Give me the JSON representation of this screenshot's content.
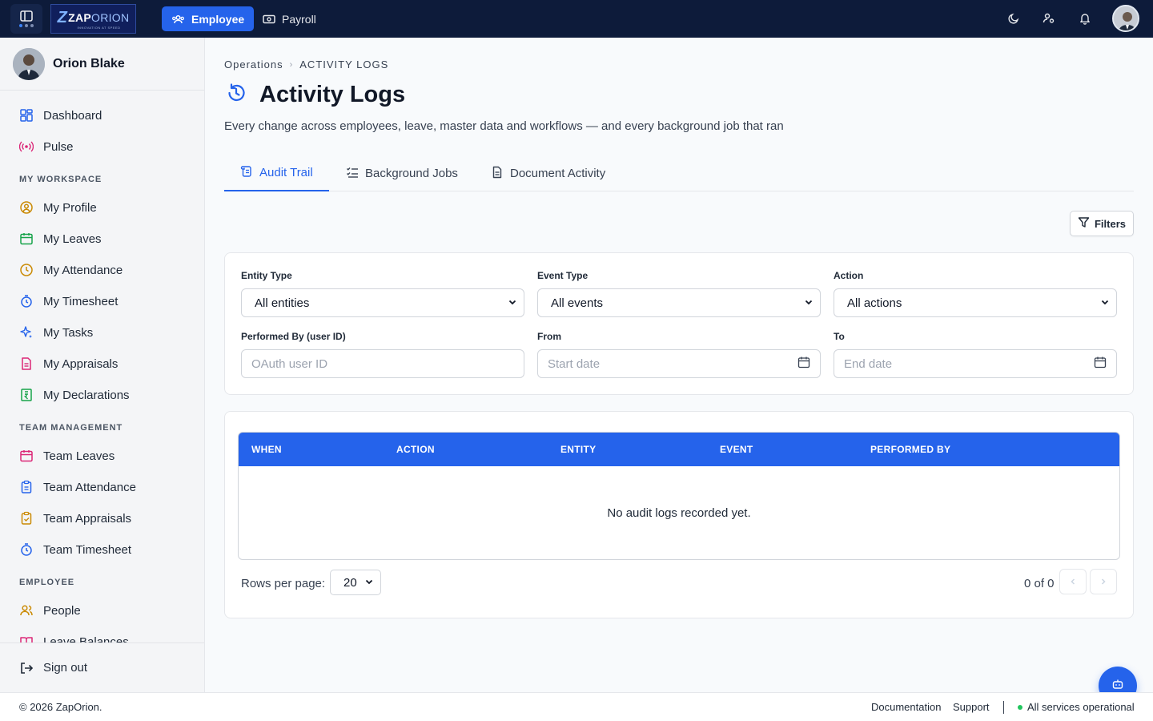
{
  "topbar": {
    "logo_text_a": "ZAP",
    "logo_text_b": "ORION",
    "logo_tagline": "INNOVATION AT SPEED",
    "nav": [
      {
        "label": "Employee",
        "active": true
      },
      {
        "label": "Payroll",
        "active": false
      }
    ],
    "icons": [
      "moon-icon",
      "users-settings-icon",
      "bell-icon"
    ]
  },
  "sidebar": {
    "user_name": "Orion Blake",
    "items_top": [
      {
        "label": "Dashboard",
        "icon": "dashboard-icon",
        "color": "#2563eb"
      },
      {
        "label": "Pulse",
        "icon": "broadcast-icon",
        "color": "#db2777"
      }
    ],
    "section_workspace": "MY WORKSPACE",
    "workspace": [
      {
        "label": "My Profile",
        "icon": "user-circle-icon",
        "color": "#ca8a04"
      },
      {
        "label": "My Leaves",
        "icon": "calendar-icon",
        "color": "#16a34a"
      },
      {
        "label": "My Attendance",
        "icon": "clock-icon",
        "color": "#ca8a04"
      },
      {
        "label": "My Timesheet",
        "icon": "stopwatch-icon",
        "color": "#2563eb"
      },
      {
        "label": "My Tasks",
        "icon": "sparkles-icon",
        "color": "#2563eb"
      },
      {
        "label": "My Appraisals",
        "icon": "document-icon",
        "color": "#db2777"
      },
      {
        "label": "My Declarations",
        "icon": "receipt-icon",
        "color": "#16a34a"
      }
    ],
    "section_team": "TEAM MANAGEMENT",
    "team": [
      {
        "label": "Team Leaves",
        "icon": "calendar-icon",
        "color": "#db2777"
      },
      {
        "label": "Team Attendance",
        "icon": "clipboard-icon",
        "color": "#2563eb"
      },
      {
        "label": "Team Appraisals",
        "icon": "clipboard-check-icon",
        "color": "#ca8a04"
      },
      {
        "label": "Team Timesheet",
        "icon": "stopwatch-icon",
        "color": "#2563eb"
      }
    ],
    "section_employee": "EMPLOYEE",
    "employee": [
      {
        "label": "People",
        "icon": "people-icon",
        "color": "#ca8a04"
      },
      {
        "label": "Leave Balances",
        "icon": "book-icon",
        "color": "#db2777"
      }
    ],
    "sign_out": "Sign out"
  },
  "main": {
    "breadcrumb_parent": "Operations",
    "breadcrumb_current": "ACTIVITY LOGS",
    "title": "Activity Logs",
    "subtitle": "Every change across employees, leave, master data and workflows — and every background job that ran",
    "tabs": [
      {
        "label": "Audit Trail",
        "active": true
      },
      {
        "label": "Background Jobs",
        "active": false
      },
      {
        "label": "Document Activity",
        "active": false
      }
    ],
    "filters_button": "Filters",
    "filters": {
      "entity_type_label": "Entity Type",
      "entity_type_value": "All entities",
      "event_type_label": "Event Type",
      "event_type_value": "All events",
      "action_label": "Action",
      "action_value": "All actions",
      "performed_by_label": "Performed By (user ID)",
      "performed_by_placeholder": "OAuth user ID",
      "from_label": "From",
      "from_placeholder": "Start date",
      "to_label": "To",
      "to_placeholder": "End date"
    },
    "table": {
      "columns": [
        "WHEN",
        "ACTION",
        "ENTITY",
        "EVENT",
        "PERFORMED BY"
      ],
      "empty_message": "No audit logs recorded yet.",
      "rows_per_page_label": "Rows per page:",
      "rows_per_page_value": "20",
      "page_count": "0 of 0"
    }
  },
  "footer": {
    "copyright": "© 2026 ZapOrion.",
    "documentation": "Documentation",
    "support": "Support",
    "status": "All services operational"
  },
  "colors": {
    "primary": "#2563eb",
    "topbar": "#0d1b3a",
    "status_ok": "#22c55e"
  }
}
